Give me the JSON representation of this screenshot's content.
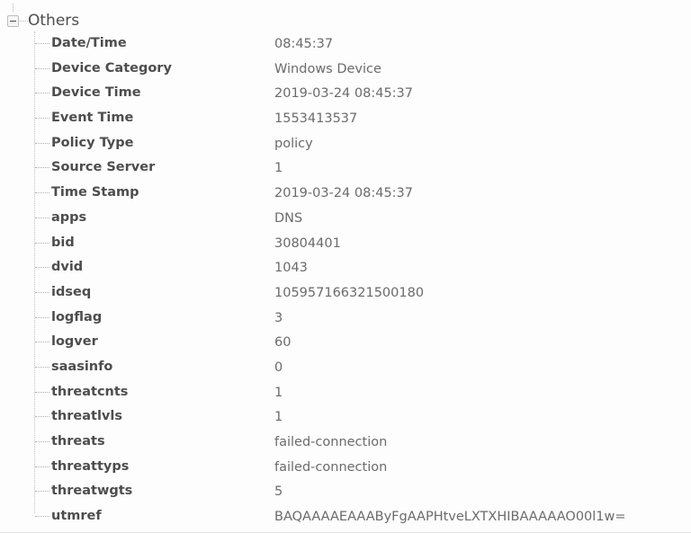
{
  "tree": {
    "root": {
      "label": "Others",
      "toggle_icon": "collapse-minus-icon",
      "expanded": true
    },
    "rows": [
      {
        "label": "Date/Time",
        "value": "08:45:37"
      },
      {
        "label": "Device Category",
        "value": "Windows Device"
      },
      {
        "label": "Device Time",
        "value": "2019-03-24 08:45:37"
      },
      {
        "label": "Event Time",
        "value": "1553413537"
      },
      {
        "label": "Policy Type",
        "value": "policy"
      },
      {
        "label": "Source Server",
        "value": "1"
      },
      {
        "label": "Time Stamp",
        "value": "2019-03-24 08:45:37"
      },
      {
        "label": "apps",
        "value": "DNS"
      },
      {
        "label": "bid",
        "value": "30804401"
      },
      {
        "label": "dvid",
        "value": "1043"
      },
      {
        "label": "idseq",
        "value": "105957166321500180"
      },
      {
        "label": "logflag",
        "value": "3"
      },
      {
        "label": "logver",
        "value": "60"
      },
      {
        "label": "saasinfo",
        "value": "0"
      },
      {
        "label": "threatcnts",
        "value": "1"
      },
      {
        "label": "threatlvls",
        "value": "1"
      },
      {
        "label": "threats",
        "value": "failed-connection"
      },
      {
        "label": "threattyps",
        "value": "failed-connection"
      },
      {
        "label": "threatwgts",
        "value": "5"
      },
      {
        "label": "utmref",
        "value": "BAQAAAAEAAAByFgAAPHtveLXTXHIBAAAAAO00l1w="
      }
    ]
  },
  "colors": {
    "background": "#fdfdfd",
    "label_text": "#4d4d4d",
    "value_text": "#6b6b6b",
    "tree_line": "#c2c2c2"
  }
}
